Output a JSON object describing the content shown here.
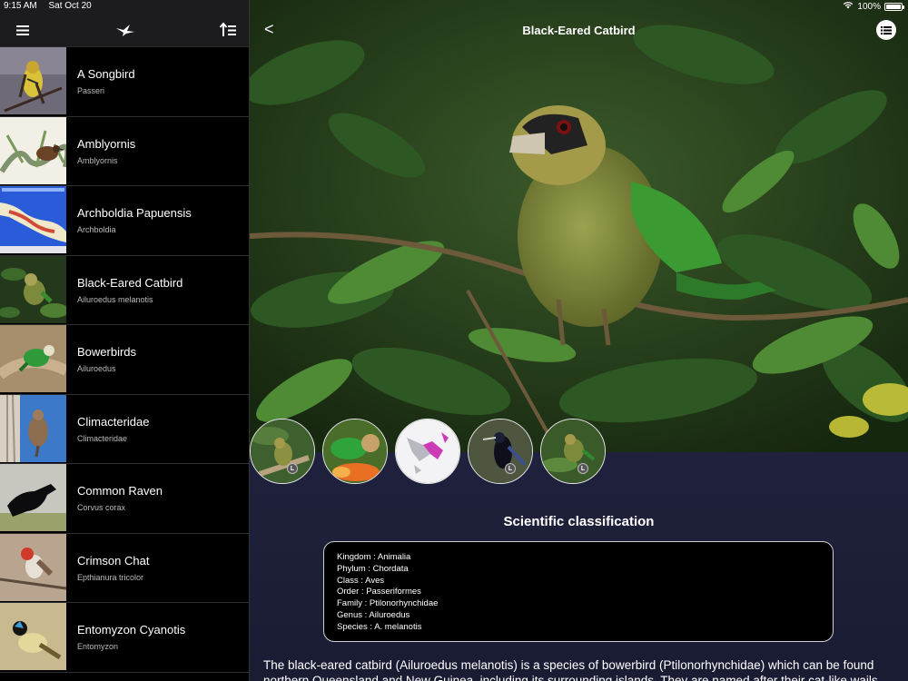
{
  "status": {
    "time": "9:15 AM",
    "date": "Sat Oct 20",
    "battery": "100%"
  },
  "sidebar": {
    "items": [
      {
        "title": "A Songbird",
        "subtitle": "Passeri"
      },
      {
        "title": "Amblyornis",
        "subtitle": "Amblyornis"
      },
      {
        "title": "Archboldia Papuensis",
        "subtitle": "Archboldia"
      },
      {
        "title": "Black-Eared Catbird",
        "subtitle": "Ailuroedus melanotis"
      },
      {
        "title": "Bowerbirds",
        "subtitle": "Ailuroedus"
      },
      {
        "title": "Climacteridae",
        "subtitle": "Climacteridae"
      },
      {
        "title": "Common Raven",
        "subtitle": "Corvus corax"
      },
      {
        "title": "Crimson Chat",
        "subtitle": "Epthianura tricolor"
      },
      {
        "title": "Entomyzon Cyanotis",
        "subtitle": "Entomyzon"
      }
    ]
  },
  "detail": {
    "title": "Black-Eared Catbird",
    "back_label": "<",
    "gallery": [
      {
        "badge": "L"
      },
      {
        "badge": ""
      },
      {
        "badge": ""
      },
      {
        "badge": "L"
      },
      {
        "badge": "L"
      }
    ],
    "classification_title": "Scientific classification",
    "classification": [
      "Kingdom : Animalia",
      "Phylum : Chordata",
      "Class : Aves",
      "Order : Passeriformes",
      "Family : Ptilonorhynchidae",
      "Genus : Ailuroedus",
      "Species : A. melanotis"
    ],
    "description": "The black-eared catbird (Ailuroedus melanotis) is a species of bowerbird (Ptilonorhynchidae) which can be found northern Queensland and New Guinea, including its surrounding islands. They are named after their cat-like wails and"
  },
  "colors": {
    "accent": "#ffffff",
    "panel_top": "#2a2d4e",
    "panel_bottom": "#1a1c34",
    "sidebar_bg": "#000000"
  },
  "icons": {
    "menu": "hamburger-icon",
    "logo": "bird-icon",
    "sort": "sort-icon",
    "list": "list-icon"
  }
}
